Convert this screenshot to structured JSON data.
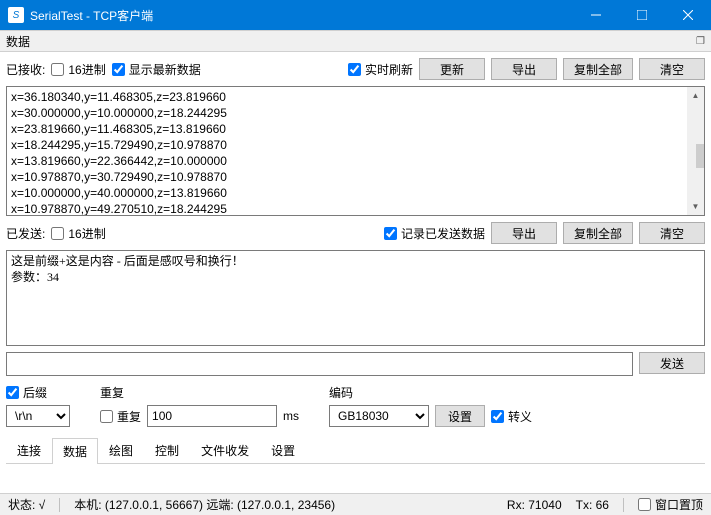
{
  "window": {
    "title": "SerialTest - TCP客户端"
  },
  "panel": {
    "title": "数据"
  },
  "recv": {
    "label": "已接收:",
    "hex": "16进制",
    "showLatest": "显示最新数据",
    "realtime": "实时刷新",
    "update": "更新",
    "export": "导出",
    "copyAll": "复制全部",
    "clear": "清空",
    "text": "x=36.180340,y=11.468305,z=23.819660\nx=30.000000,y=10.000000,z=18.244295\nx=23.819660,y=11.468305,z=13.819660\nx=18.244295,y=15.729490,z=10.978870\nx=13.819660,y=22.366442,z=10.000000\nx=10.978870,y=30.729490,z=10.978870\nx=10.000000,y=40.000000,z=13.819660\nx=10.978870,y=49.270510,z=18.244295"
  },
  "send": {
    "label": "已发送:",
    "hex": "16进制",
    "logSent": "记录已发送数据",
    "export": "导出",
    "copyAll": "复制全部",
    "clear": "清空",
    "text": "这是前缀+这是内容 - 后面是感叹号和换行！\n参数：34",
    "sendBtn": "发送"
  },
  "suffix": {
    "label": "后缀",
    "value": "\\r\\n"
  },
  "repeat": {
    "label": "重复",
    "chk": "重复",
    "value": "100",
    "unit": "ms"
  },
  "encoding": {
    "label": "编码",
    "value": "GB18030",
    "setBtn": "设置",
    "escape": "转义"
  },
  "tabs": [
    "连接",
    "数据",
    "绘图",
    "控制",
    "文件收发",
    "设置"
  ],
  "activeTab": 1,
  "status": {
    "state": "状态: √",
    "addr": "本机: (127.0.0.1, 56667) 远端: (127.0.0.1, 23456)",
    "rx": "Rx: 71040",
    "tx": "Tx: 66",
    "onTop": "窗口置顶"
  }
}
